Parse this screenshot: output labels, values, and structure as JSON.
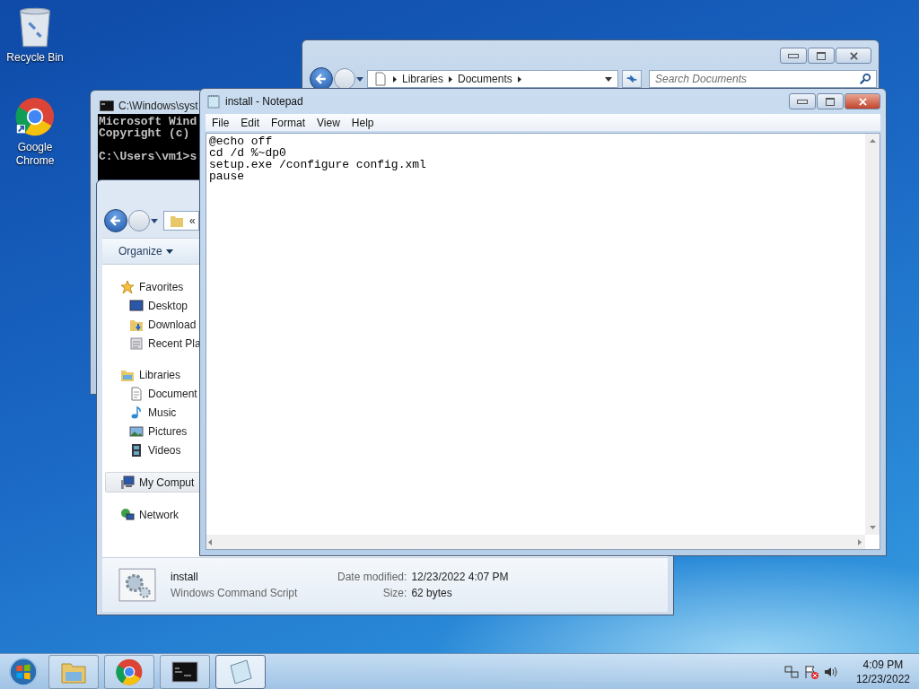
{
  "desktop_icons": [
    {
      "kind": "recycle",
      "label": "Recycle Bin"
    },
    {
      "kind": "chrome",
      "label": "Google Chrome"
    }
  ],
  "documents_window": {
    "breadcrumb": [
      "Libraries",
      "Documents"
    ],
    "search": {
      "placeholder": "Search Documents"
    }
  },
  "cmd_window": {
    "title": "C:\\Windows\\syst",
    "lines": [
      {
        "text": "Microsoft Wind",
        "blank_before": false
      },
      {
        "text": "Copyright (c)",
        "blank_before": false
      },
      {
        "text": "C:\\Users\\vm1>s",
        "blank_before": true
      }
    ]
  },
  "explorer_window": {
    "path_overflow": "«",
    "toolbar": {
      "organize": "Organize"
    },
    "nav": [
      {
        "kind": "star",
        "label": "Favorites",
        "selected": false,
        "children": [
          {
            "kind": "desktop",
            "label": "Desktop",
            "selected": false
          },
          {
            "kind": "downloads",
            "label": "Download",
            "selected": false
          },
          {
            "kind": "recent",
            "label": "Recent Pla",
            "selected": false
          }
        ]
      },
      {
        "kind": "library",
        "label": "Libraries",
        "selected": false,
        "children": [
          {
            "kind": "document",
            "label": "Document",
            "selected": false
          },
          {
            "kind": "music",
            "label": "Music",
            "selected": false
          },
          {
            "kind": "pictures",
            "label": "Pictures",
            "selected": false
          },
          {
            "kind": "videos",
            "label": "Videos",
            "selected": false
          }
        ]
      },
      {
        "kind": "computer",
        "label": "My Comput",
        "selected": true
      },
      {
        "kind": "network",
        "label": "Network",
        "selected": false
      }
    ],
    "details": {
      "name": "install",
      "type": "Windows Command Script",
      "fields": [
        {
          "label": "Date modified:",
          "value": "12/23/2022 4:07 PM"
        },
        {
          "label": "Size:",
          "value": "62 bytes"
        }
      ]
    }
  },
  "notepad": {
    "title": "install - Notepad",
    "menu": [
      "File",
      "Edit",
      "Format",
      "View",
      "Help"
    ],
    "lines": [
      "@echo off",
      "cd /d %~dp0",
      "setup.exe /configure config.xml",
      "pause"
    ]
  },
  "taskbar": {
    "items": [
      {
        "kind": "explorer",
        "selected": false
      },
      {
        "kind": "chrome",
        "selected": false
      },
      {
        "kind": "cmd",
        "selected": false
      },
      {
        "kind": "notepad",
        "selected": true
      }
    ],
    "clock": {
      "time": "4:09 PM",
      "date": "12/23/2022"
    }
  }
}
